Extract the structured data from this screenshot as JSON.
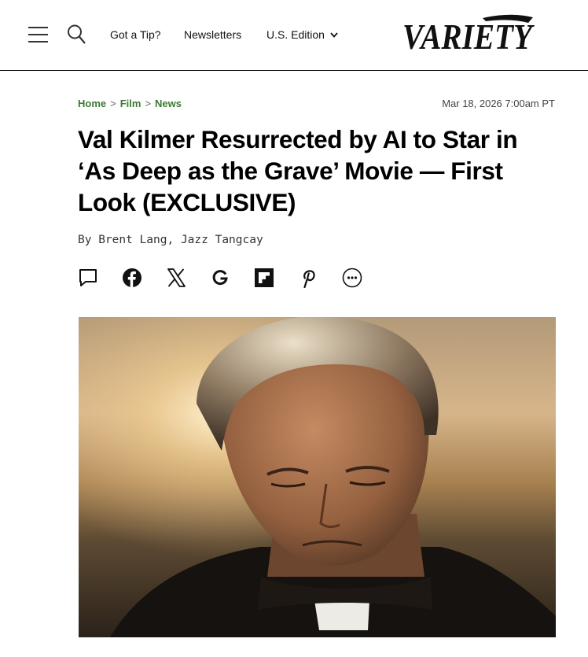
{
  "header": {
    "nav": {
      "tip": "Got a Tip?",
      "newsletters": "Newsletters",
      "edition": "U.S. Edition"
    },
    "logo": "VARIETY"
  },
  "breadcrumb": {
    "items": [
      "Home",
      "Film",
      "News"
    ],
    "separator": ">"
  },
  "article": {
    "timestamp": "Mar 18, 2026 7:00am PT",
    "headline": "Val Kilmer Resurrected by AI to Star in ‘As Deep as the Grave’ Movie — First Look (EXCLUSIVE)",
    "byline": "By Brent Lang, Jazz Tangcay"
  },
  "share_icons": [
    "comment-icon",
    "facebook-icon",
    "x-icon",
    "google-icon",
    "flipboard-icon",
    "pinterest-icon",
    "more-icon"
  ],
  "colors": {
    "breadcrumb": "#3b7a34",
    "rule": "#000000"
  }
}
